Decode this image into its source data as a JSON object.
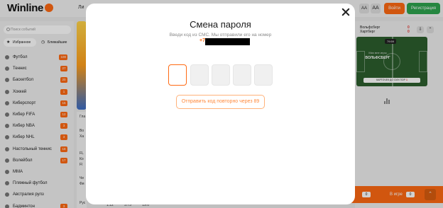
{
  "header": {
    "logo_text": "Winline",
    "nav_fragment": "Ли",
    "font_small": "AA",
    "font_large": "AA",
    "login_label": "Войти",
    "register_label": "Регистрация"
  },
  "sidebar": {
    "search_placeholder": "Поиск событий",
    "tabs": [
      {
        "label": "Избранное",
        "icon": "star-icon"
      },
      {
        "label": "Ближайшие",
        "icon": "clock-icon"
      }
    ],
    "sports": [
      {
        "label": "Футбол",
        "count": "100"
      },
      {
        "label": "Теннис",
        "count": "27"
      },
      {
        "label": "Баскетбол",
        "count": "20"
      },
      {
        "label": "Хоккей",
        "count": "1"
      },
      {
        "label": "Киберспорт",
        "count": "15"
      },
      {
        "label": "Кибер FIFA",
        "count": "12"
      },
      {
        "label": "Кибер NBA",
        "count": "3"
      },
      {
        "label": "Кибер NHL",
        "count": "3"
      },
      {
        "label": "Настольный теннис",
        "count": "18"
      },
      {
        "label": "Волейбол",
        "count": "17"
      },
      {
        "label": "MMA",
        "count": ""
      },
      {
        "label": "Пляжный футбол",
        "count": ""
      },
      {
        "label": "Австралия рулз",
        "count": ""
      },
      {
        "label": "Бадминтон",
        "count": "3"
      }
    ]
  },
  "main": {
    "fragments": [
      "Гла",
      "Во",
      "Ха",
      "FL",
      "Ко",
      "Fl",
      "Че",
      "Фи",
      "Рус"
    ],
    "odds": [
      "1.12",
      "5.75",
      "19.0"
    ]
  },
  "right_panel": {
    "team1": "Вольфсберг",
    "team2": "Хартберг",
    "score1": "0",
    "score2": "0",
    "clock": "79:59",
    "pitch_label": "Мяч вне игры",
    "pitch_team": "ВОЛЬФСБЕРГ",
    "pitch_card": "КАРТОЧЕК ДО СИХ ПОР",
    "card_count": "1"
  },
  "bottom_bar": {
    "coupon_count": "0",
    "in_game_label": "В игре",
    "in_game_count": "0"
  },
  "modal": {
    "title": "Смена пароля",
    "subtitle": "Введи код из СМС. Мы отправили его на номер",
    "phone_prefix": "+7",
    "resend_label": "Отправить код повторно через 89",
    "code_digits": [
      "",
      "",
      "",
      "",
      ""
    ]
  },
  "colors": {
    "accent": "#ff6a13",
    "register": "#2ea44f"
  }
}
